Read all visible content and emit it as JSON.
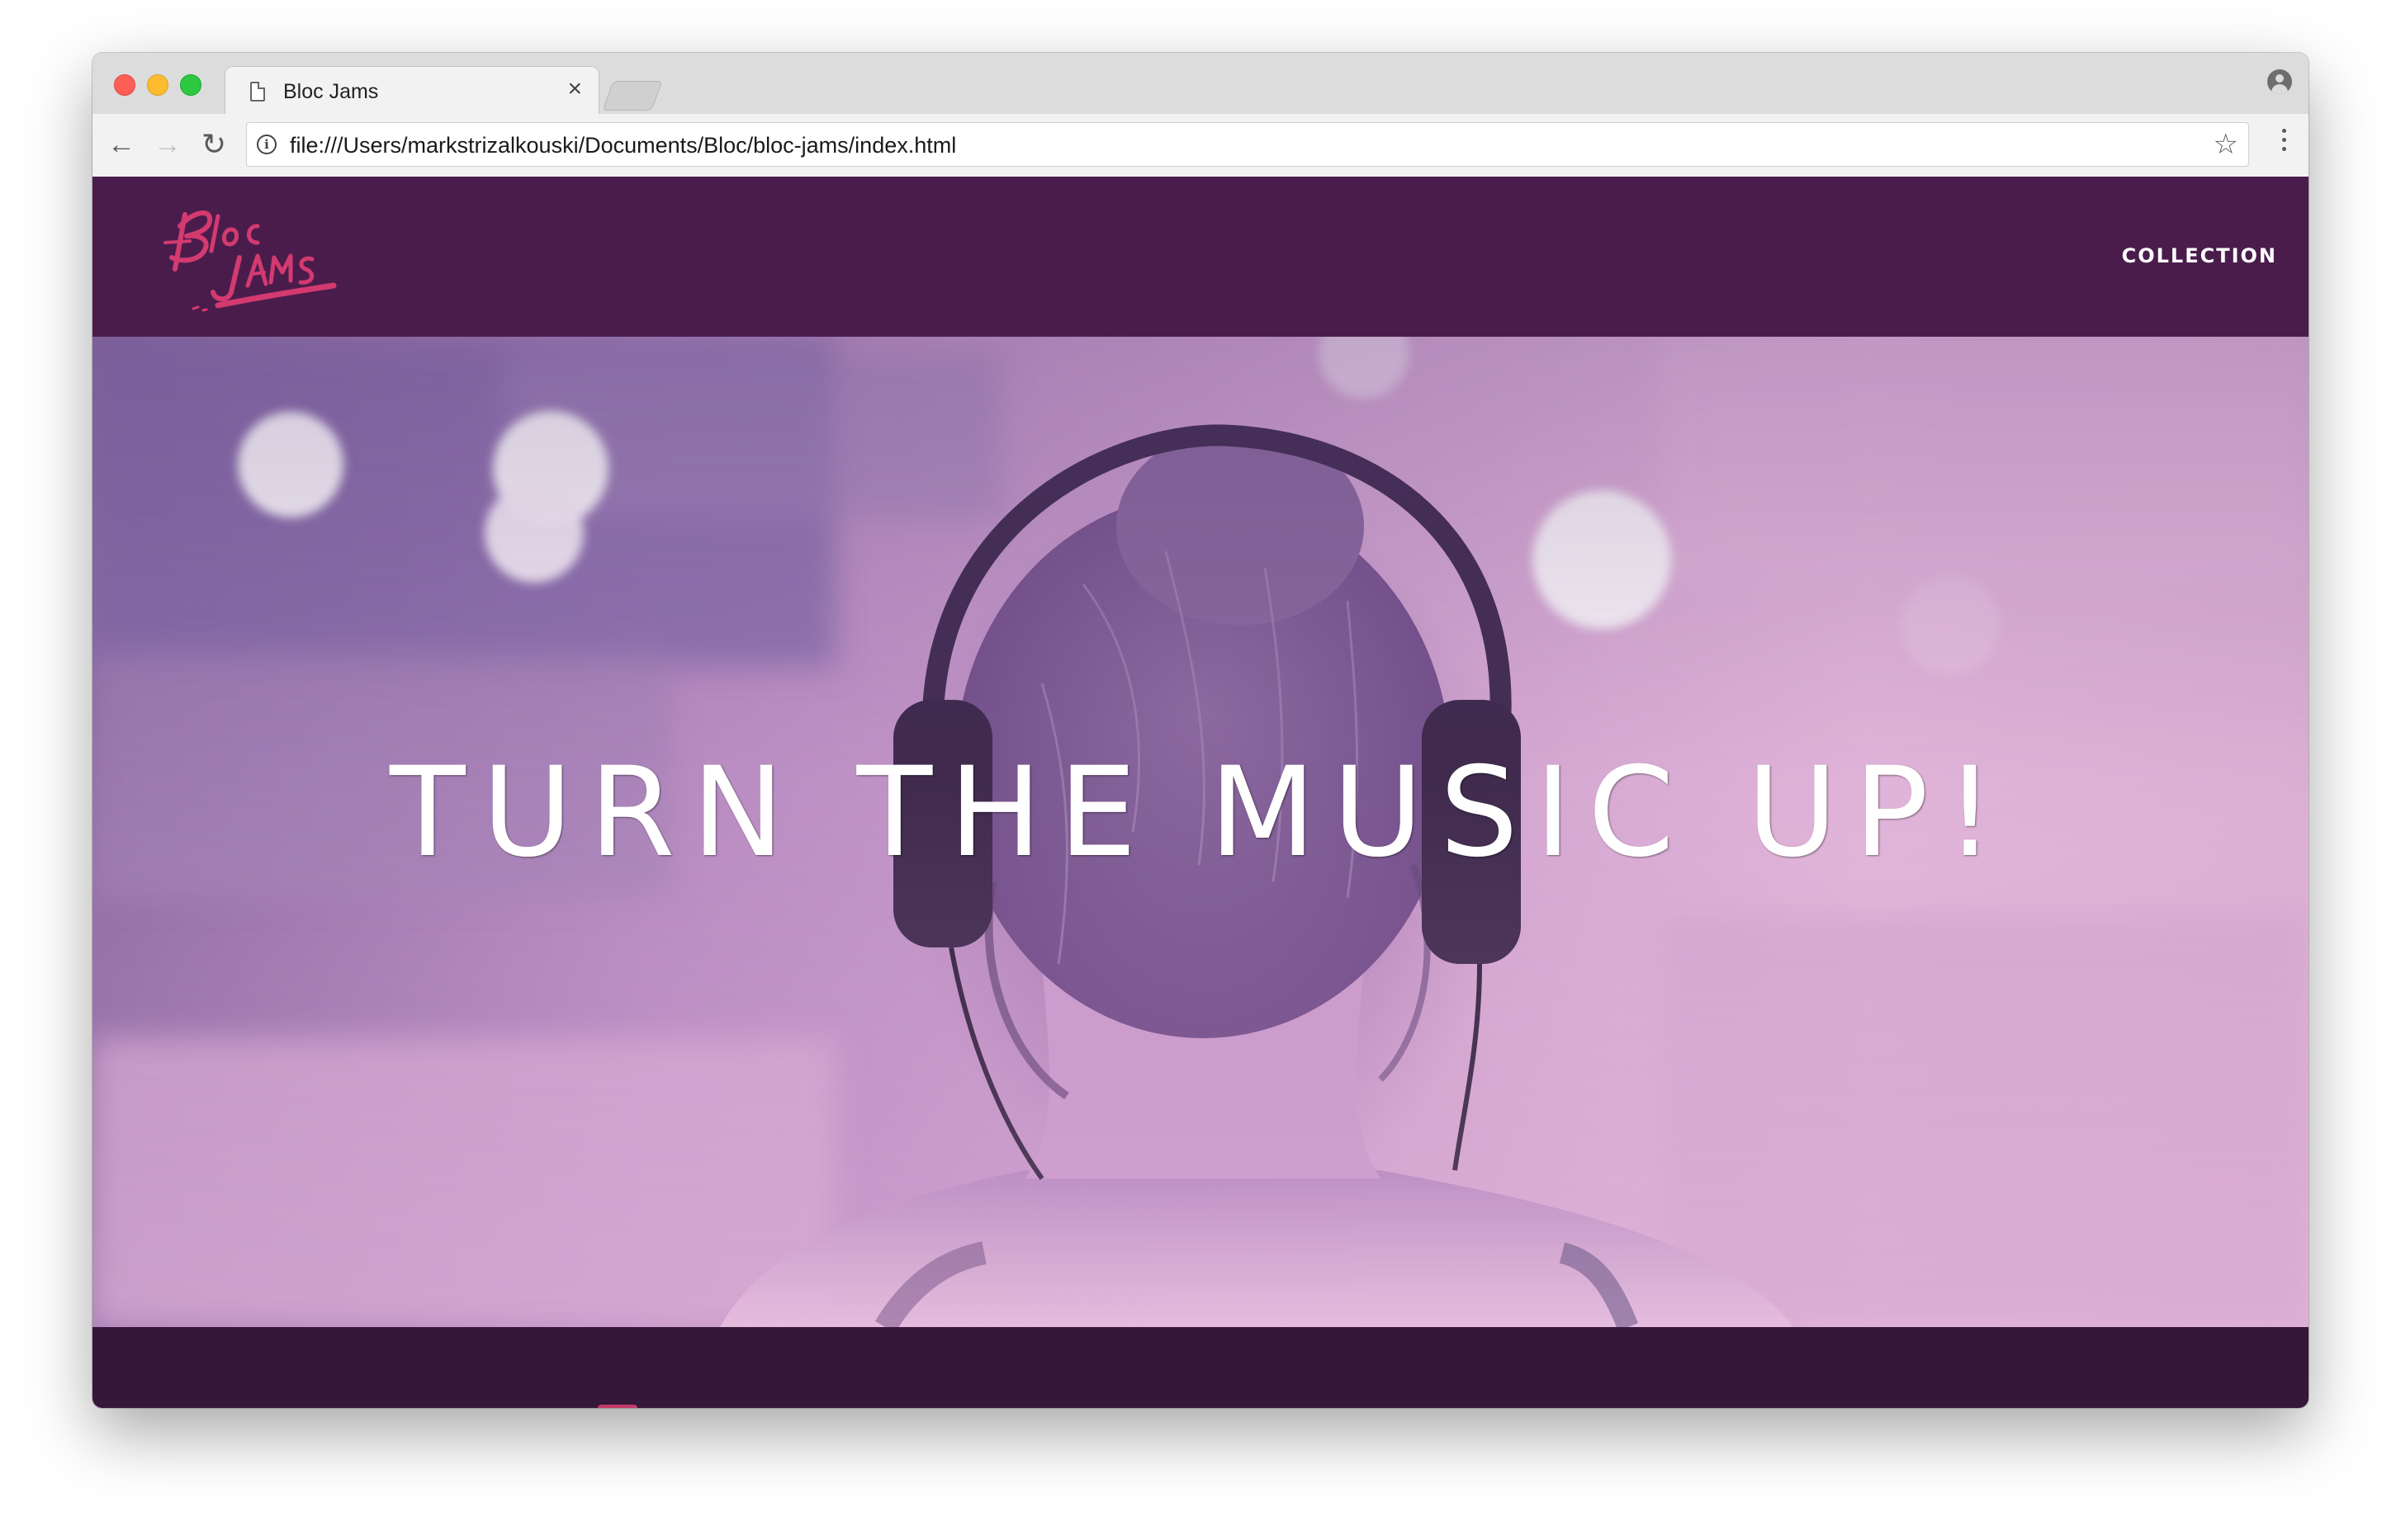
{
  "browser": {
    "tab": {
      "title": "Bloc Jams",
      "close_glyph": "×",
      "icon": "document-icon"
    },
    "toolbar": {
      "back_glyph": "←",
      "forward_glyph": "→",
      "reload_glyph": "↻",
      "url": "file:///Users/markstrizalkouski/Documents/Bloc/bloc-jams/index.html",
      "info_glyph": "i",
      "bookmark_glyph": "☆"
    },
    "profile_icon": "account-circle-icon",
    "menu_icon": "vertical-dots-icon"
  },
  "site": {
    "nav": {
      "logo_icon": "bloc-jams-logo",
      "collection_label": "COLLECTION"
    },
    "hero": {
      "title": "TURN THE MUSIC UP!"
    }
  },
  "colors": {
    "nav_background": "#4a1c4c",
    "band_background": "#361639",
    "logo_color": "#d33a70",
    "hero_tint": "#c99ccc"
  }
}
